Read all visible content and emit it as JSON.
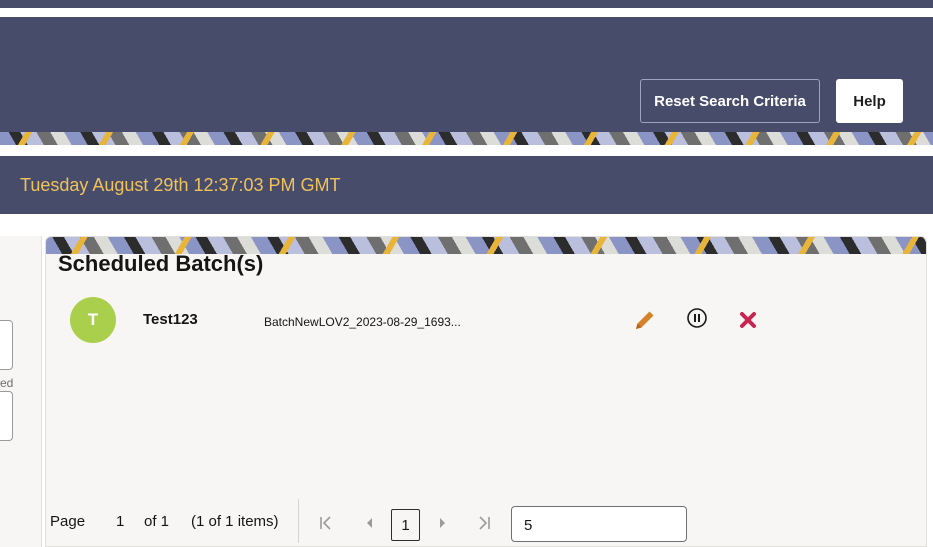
{
  "header": {
    "reset_button_label": "Reset Search Criteria",
    "help_button_label": "Help"
  },
  "datebar": {
    "date_text": "Tuesday August 29th 12:37:03 PM GMT"
  },
  "left_panel": {
    "truncated_label": "ed"
  },
  "scheduled": {
    "title": "Scheduled Batch(s)",
    "items": [
      {
        "avatar_letter": "T",
        "name": "Test123",
        "description": "BatchNewLOV2_2023-08-29_1693..."
      }
    ]
  },
  "pager": {
    "page_label": "Page",
    "page_value": "1",
    "of_label": "of 1",
    "items_label": "(1 of 1 items)",
    "current_page": "1",
    "page_size": "5"
  },
  "colors": {
    "header_bg": "#474c6b",
    "date_text": "#f0c25a",
    "avatar_bg": "#a9cf4d",
    "edit_icon": "#d6822a",
    "delete_icon": "#c8254f"
  }
}
